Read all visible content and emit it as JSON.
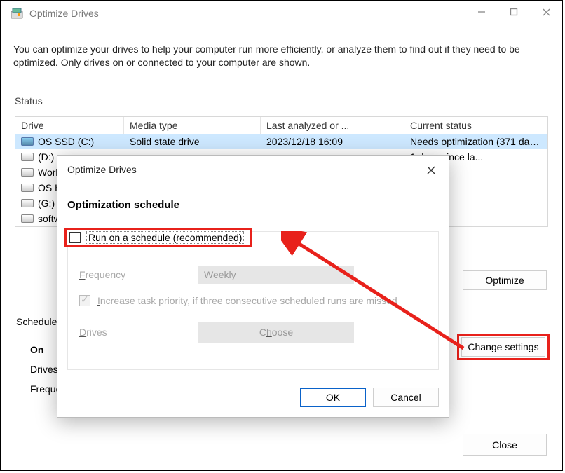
{
  "window": {
    "title": "Optimize Drives",
    "description": "You can optimize your drives to help your computer run more efficiently, or analyze them to find out if they need to be optimized. Only drives on or connected to your computer are shown."
  },
  "statusLabel": "Status",
  "headers": {
    "drive": "Drive",
    "media": "Media type",
    "last": "Last analyzed or ...",
    "status": "Current status"
  },
  "rows": [
    {
      "name": "OS SSD (C:)",
      "media": "Solid state drive",
      "last": "2023/12/18 16:09",
      "status": "Needs optimization (371 days since la...",
      "ssd": true
    },
    {
      "name": "(D:)",
      "media": "",
      "last": "",
      "status": "1 days since la..."
    },
    {
      "name": "Work",
      "media": "",
      "last": "",
      "status": ""
    },
    {
      "name": "OS HI",
      "media": "",
      "last": "",
      "status": ""
    },
    {
      "name": "(G:)",
      "media": "",
      "last": "",
      "status": ""
    },
    {
      "name": "softw",
      "media": "",
      "last": "",
      "status": ""
    }
  ],
  "buttons": {
    "optimize": "Optimize",
    "changeSettings": "Change settings",
    "close": "Close"
  },
  "scheduled": {
    "section": "Scheduled",
    "on": "On",
    "drivesLabel": "Drives",
    "freqLabel": "Freque"
  },
  "dialog": {
    "title": "Optimize Drives",
    "heading": "Optimization schedule",
    "runSchedulePrefixU": "R",
    "runScheduleRest": "un on a schedule (recommended)",
    "freqPrefixU": "F",
    "freqRest": "requency",
    "freqValue": "Weekly",
    "priPrefixU": "I",
    "priRest": "ncrease task priority, if three consecutive scheduled runs are missed",
    "drivesPrefixU": "D",
    "drivesRest": "rives",
    "choosePrefix": "C",
    "chooseU": "h",
    "chooseRest": "oose",
    "ok": "OK",
    "cancel": "Cancel"
  }
}
